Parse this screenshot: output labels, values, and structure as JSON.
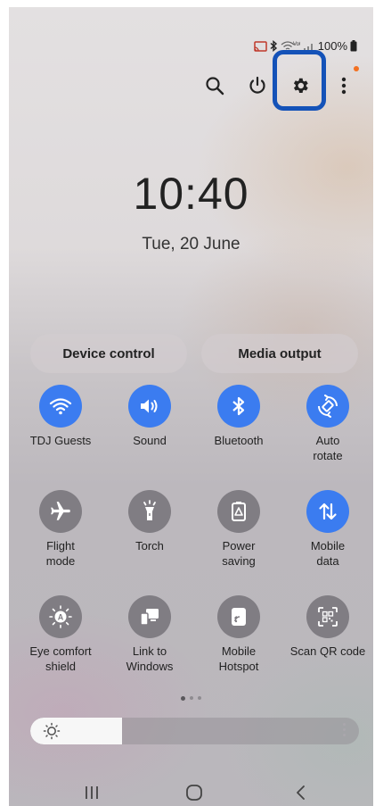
{
  "status_bar": {
    "battery_text": "100%",
    "icons": [
      "cast-icon",
      "bluetooth-icon",
      "wifi-calling-icon",
      "signal-icon",
      "battery-icon"
    ]
  },
  "toolbar": {
    "icons": [
      "search-icon",
      "power-icon",
      "settings-icon",
      "more-options-icon"
    ],
    "highlighted": "settings-icon"
  },
  "clock": {
    "time": "10:40",
    "date": "Tue, 20 June"
  },
  "buttons": {
    "device_control": "Device control",
    "media_output": "Media output"
  },
  "tiles": [
    {
      "label": "TDJ Guests",
      "icon": "wifi-icon",
      "state": "on"
    },
    {
      "label": "Sound",
      "icon": "sound-icon",
      "state": "on"
    },
    {
      "label": "Bluetooth",
      "icon": "bluetooth-icon",
      "state": "on"
    },
    {
      "label": "Auto\nrotate",
      "icon": "auto-rotate-icon",
      "state": "on"
    },
    {
      "label": "Flight\nmode",
      "icon": "airplane-icon",
      "state": "off"
    },
    {
      "label": "Torch",
      "icon": "torch-icon",
      "state": "off"
    },
    {
      "label": "Power\nsaving",
      "icon": "power-saving-icon",
      "state": "off"
    },
    {
      "label": "Mobile\ndata",
      "icon": "mobile-data-icon",
      "state": "on"
    },
    {
      "label": "Eye comfort\nshield",
      "icon": "eye-comfort-icon",
      "state": "off"
    },
    {
      "label": "Link to\nWindows",
      "icon": "link-to-windows-icon",
      "state": "off"
    },
    {
      "label": "Mobile\nHotspot",
      "icon": "hotspot-icon",
      "state": "off"
    },
    {
      "label": "Scan QR code",
      "icon": "qr-code-icon",
      "state": "off"
    }
  ],
  "pagination": {
    "pages": 3,
    "current": 1
  },
  "brightness": {
    "level": 0.28
  },
  "nav_bar": {
    "icons": [
      "recent-apps-icon",
      "home-icon",
      "back-icon"
    ]
  },
  "colors": {
    "accent": "#3b7cf0",
    "tile_off": "#807d83",
    "highlight": "#1452b8",
    "notification_dot": "#f37021"
  }
}
